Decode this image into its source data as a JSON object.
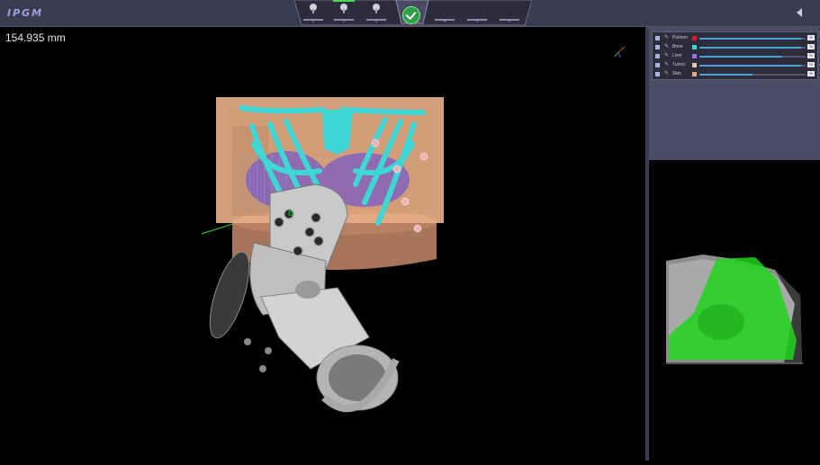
{
  "app": {
    "logo": "IPGM"
  },
  "workflow": {
    "steps": [
      {
        "label": "1"
      },
      {
        "label": "2"
      },
      {
        "label": "3"
      },
      {
        "label": "4"
      },
      {
        "label": "5"
      },
      {
        "label": "6"
      }
    ]
  },
  "viewport": {
    "measurement": "154.935 mm"
  },
  "layers": [
    {
      "name": "Pulmon",
      "color": "#e11d1d",
      "level": 0.96,
      "value": "%"
    },
    {
      "name": "Bone",
      "color": "#3fd6d6",
      "level": 0.96,
      "value": "%"
    },
    {
      "name": "Liver",
      "color": "#9a70e0",
      "level": 0.78,
      "value": "%"
    },
    {
      "name": "Tumor",
      "color": "#f0c8a0",
      "level": 0.96,
      "value": "%"
    },
    {
      "name": "Skin",
      "color": "#e9a77a",
      "level": 0.5,
      "value": "%"
    }
  ],
  "colors": {
    "toolbar": "#3b3b4f",
    "accent": "#2ea04a",
    "bone": "#3fd6d6",
    "skin": "#d9a37e",
    "segmentation": "#22d41f"
  },
  "icons": [
    "collapse-arrow-icon",
    "surgical-tool-icon",
    "confirm-check-icon",
    "pen-icon",
    "axis-gizmo-icon"
  ]
}
